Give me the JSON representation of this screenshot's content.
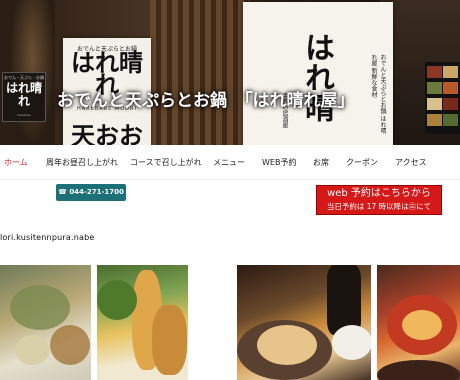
{
  "hero": {
    "title": "おでんと天ぷらとお鍋　「はれ晴れ屋」",
    "noren_left": {
      "small": "おでんと天ぷらとお鍋",
      "big": "はれ晴れ",
      "roman": "HAREBARE MODRI",
      "fragment": "天おお"
    },
    "noren_right": {
      "vertical": "はれ晴",
      "side_text": "おでんと天ぷらとお鍋 はれ晴れ屋 新鮮な食材",
      "side_text_left": "まちの居酒屋"
    },
    "logo": {
      "top": "おでん・天ぷら・お鍋",
      "main": "はれ晴れ",
      "bottom": "harebare"
    }
  },
  "nav": {
    "items": [
      {
        "label": "ホーム",
        "active": true
      },
      {
        "label": "周年お昼召し上がれ",
        "active": false
      },
      {
        "label": "コースで召し上がれ",
        "active": false
      },
      {
        "label": "メニュー",
        "active": false
      },
      {
        "label": "WEB予約",
        "active": false
      },
      {
        "label": "お席",
        "active": false
      },
      {
        "label": "クーポン",
        "active": false
      },
      {
        "label": "アクセス",
        "active": false
      }
    ]
  },
  "phone": {
    "label": "☎ 044-271-1700"
  },
  "reserve": {
    "line1": "web 予約はこちらから",
    "line2": "当日予約は 17 時以降は㊂にて"
  },
  "handle": "lori.kusitennpura.nabe",
  "colors": {
    "accent_red": "#d51818",
    "phone_teal": "#1d6f78",
    "nav_active": "#dd2233"
  },
  "photos": [
    {
      "icon": "tempura-plate-photo"
    },
    {
      "icon": "shrimp-tempura-photo"
    },
    {
      "icon": "oden-pot-photo"
    },
    {
      "icon": "hotpot-photo"
    }
  ]
}
